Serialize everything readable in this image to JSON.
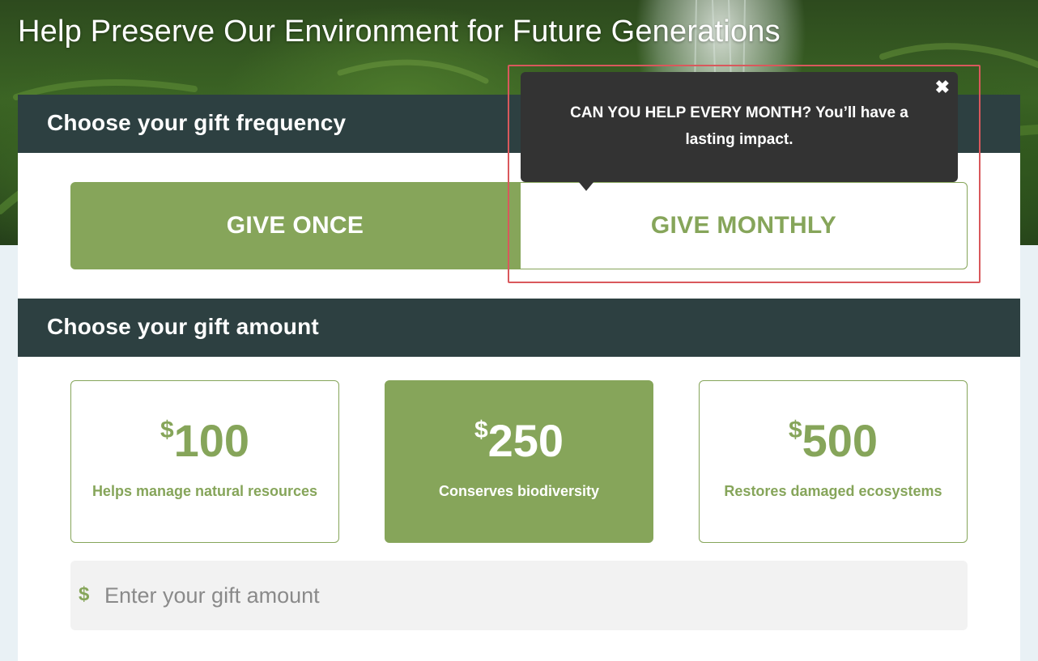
{
  "page": {
    "title": "Help Preserve Our Environment for Future Generations",
    "accent_color": "#86a55a",
    "header_color": "#2d4041"
  },
  "frequency": {
    "heading": "Choose your gift frequency",
    "options": [
      {
        "label": "GIVE ONCE",
        "selected": true
      },
      {
        "label": "GIVE MONTHLY",
        "selected": false
      }
    ]
  },
  "tooltip": {
    "text": "CAN YOU HELP EVERY MONTH? You’ll have a lasting impact.",
    "close_glyph": "✖",
    "close_icon": "close-icon"
  },
  "amount": {
    "heading": "Choose your gift amount",
    "currency_symbol": "$",
    "options": [
      {
        "value": "100",
        "description": "Helps manage natural resources",
        "selected": false
      },
      {
        "value": "250",
        "description": "Conserves biodiversity",
        "selected": true
      },
      {
        "value": "500",
        "description": "Restores damaged ecosystems",
        "selected": false
      }
    ],
    "custom": {
      "prefix": "$",
      "placeholder": "Enter your gift amount",
      "value": ""
    }
  }
}
